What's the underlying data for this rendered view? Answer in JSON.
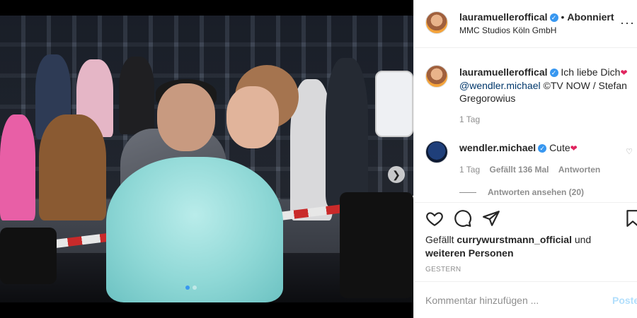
{
  "post": {
    "author": "lauramuelleroffical",
    "follow_state": "Abonniert",
    "location": "MMC Studios Köln GmbH",
    "caption_author": "lauramuelleroffical",
    "caption_text": "Ich liebe Dich",
    "caption_mention": "@wendler.michael",
    "caption_credit": "©TV NOW / Stefan Gregorowius",
    "caption_time": "1 Tag",
    "comment": {
      "author": "wendler.michael",
      "text": "Cute",
      "time": "1 Tag",
      "likes": "Gefällt 136 Mal",
      "reply": "Antworten",
      "view_replies": "Antworten ansehen (20)"
    },
    "liked_by_prefix": "Gefällt",
    "liked_by_user": "currywurstmann_official",
    "liked_by_suffix": "und",
    "liked_by_others": "weiteren Personen",
    "date": "GESTERN",
    "comment_placeholder": "Kommentar hinzufügen ...",
    "post_label": "Posten"
  },
  "icons": [
    "verified-badge-icon",
    "more-options-icon",
    "heart-icon",
    "comment-icon",
    "share-icon",
    "bookmark-icon",
    "chevron-right-icon"
  ],
  "colors": {
    "link": "#00376b",
    "verified": "#3897f0",
    "post_button": "#b2dffc",
    "muted": "#8e8e8e"
  },
  "carousel": {
    "count": 2,
    "active": 1
  }
}
